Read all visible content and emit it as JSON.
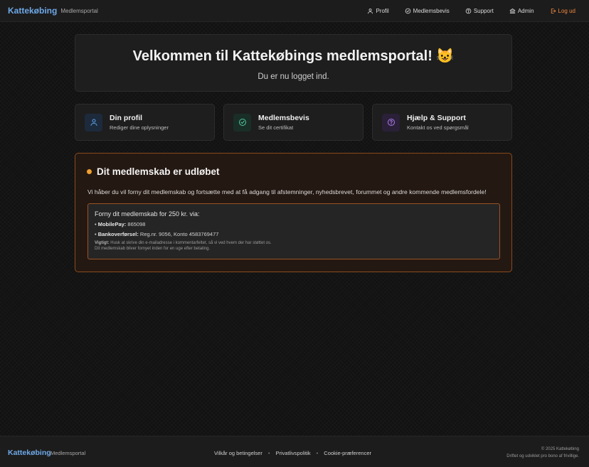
{
  "header": {
    "brand": "Kattekøbing",
    "subtitle": "Medlemsportal",
    "nav": [
      {
        "label": "Profil",
        "icon": "user-icon"
      },
      {
        "label": "Medlemsbevis",
        "icon": "check-circle-icon"
      },
      {
        "label": "Support",
        "icon": "help-circle-icon"
      },
      {
        "label": "Admin",
        "icon": "bank-icon"
      },
      {
        "label": "Log ud",
        "icon": "logout-icon"
      }
    ]
  },
  "welcome": {
    "title": "Velkommen til Kattekøbings medlemsportal! 😺",
    "subtitle": "Du er nu logget ind."
  },
  "cards": [
    {
      "title": "Din profil",
      "subtitle": "Rediger dine oplysninger",
      "icon": "user-icon",
      "accent": "#5aa0e8"
    },
    {
      "title": "Medlemsbevis",
      "subtitle": "Se dit certifikat",
      "icon": "check-circle-icon",
      "accent": "#4ec9a0"
    },
    {
      "title": "Hjælp & Support",
      "subtitle": "Kontakt os ved spørgsmål",
      "icon": "help-circle-icon",
      "accent": "#b07cf0"
    }
  ],
  "expired": {
    "title": "Dit medlemskab er udløbet",
    "lead": "Vi håber du vil forny dit medlemskab og fortsætte med at få adgang til afstemninger, nyhedsbrevet, forummet og andre kommende medlemsfordele!",
    "renew_title": "Forny dit medlemskab for 250 kr. via:",
    "mobilepay_label": "MobilePay:",
    "mobilepay_value": "865098",
    "bank_label": "Bankoverførsel:",
    "bank_value": "Reg.nr. 9056, Konto 4583769477",
    "note_label": "Vigtigt:",
    "note_text": "Husk at skrive din e-mailadresse i kommentarfeltet, så vi ved hvem der har støttet os.",
    "note_text2": "Dit medlemskab bliver fornyet inden for en uge efter betaling.",
    "accent": "#f0a030"
  },
  "footer": {
    "brand": "Kattekøbing",
    "subtitle": "Medlemsportal",
    "links": [
      "Vilkår og betingelser",
      "Privatlivspolitik",
      "Cookie-præferencer"
    ],
    "copyright": "© 2025 Kattekøbing",
    "tagline": "Driftet og udviklet pro bono af frivillige."
  },
  "colors": {
    "brand": "#6ea8e8",
    "logout": "#f0883e",
    "background": "#121212"
  }
}
